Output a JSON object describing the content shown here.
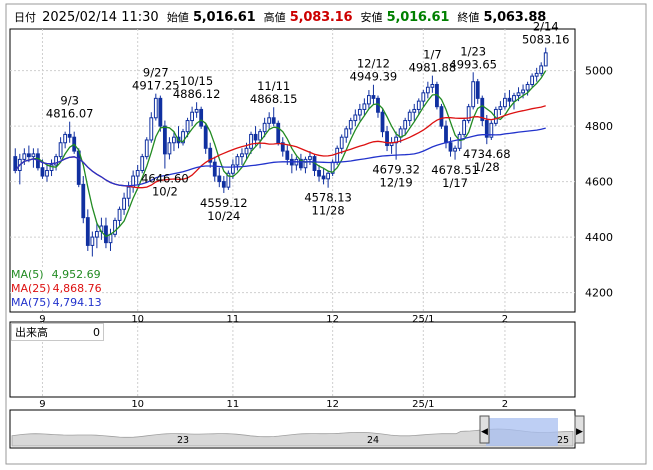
{
  "header": {
    "date_label": "日付",
    "datetime": "2025/02/14 11:30",
    "open_label": "始値",
    "open": "5,016.61",
    "high_label": "高値",
    "high": "5,083.16",
    "low_label": "安値",
    "low": "5,016.61",
    "close_label": "終値",
    "close": "5,063.88"
  },
  "legend": {
    "ma5_label": "MA(5)",
    "ma5": "4,952.69",
    "ma5_color": "#228b22",
    "ma25_label": "MA(25)",
    "ma25": "4,868.76",
    "ma25_color": "#dd1111",
    "ma75_label": "MA(75)",
    "ma75": "4,794.13",
    "ma75_color": "#2233cc"
  },
  "volume": {
    "label": "出来高",
    "value": "0"
  },
  "colors": {
    "up": "#1030a0",
    "down": "#1030a0",
    "high_text": "#cc0000",
    "low_text": "#008000"
  },
  "chart_data": {
    "type": "candlestick",
    "y_axis": {
      "ticks": [
        4200,
        4400,
        4600,
        4800,
        5000
      ],
      "range": [
        4130,
        5150
      ],
      "side": "right"
    },
    "x_axis": {
      "month_labels": [
        "9",
        "10",
        "11",
        "12",
        "25/1",
        "2"
      ]
    },
    "mini_axis_labels": [
      "23",
      "24",
      "25"
    ],
    "grid": true,
    "annotations": [
      {
        "text": "9/3",
        "price": 4816.07,
        "kind": "high",
        "date_index": 12
      },
      {
        "text": "4816.07",
        "price": 4816.07,
        "kind": "high-value",
        "date_index": 12
      },
      {
        "text": "9/27",
        "price": 4917.25,
        "kind": "high",
        "date_index": 31
      },
      {
        "text": "4917.25",
        "price": 4917.25,
        "kind": "high-value",
        "date_index": 31
      },
      {
        "text": "10/15",
        "price": 4886.12,
        "kind": "high",
        "date_index": 40
      },
      {
        "text": "4886.12",
        "price": 4886.12,
        "kind": "high-value",
        "date_index": 40
      },
      {
        "text": "4646.60",
        "price": 4646.6,
        "kind": "low-value",
        "date_index": 33
      },
      {
        "text": "10/2",
        "price": 4646.6,
        "kind": "low",
        "date_index": 33
      },
      {
        "text": "4559.12",
        "price": 4559.12,
        "kind": "low-value",
        "date_index": 46
      },
      {
        "text": "10/24",
        "price": 4559.12,
        "kind": "low",
        "date_index": 46
      },
      {
        "text": "11/11",
        "price": 4868.15,
        "kind": "high",
        "date_index": 57
      },
      {
        "text": "4868.15",
        "price": 4868.15,
        "kind": "high-value",
        "date_index": 57
      },
      {
        "text": "4578.13",
        "price": 4578.13,
        "kind": "low-value",
        "date_index": 69
      },
      {
        "text": "11/28",
        "price": 4578.13,
        "kind": "low",
        "date_index": 69
      },
      {
        "text": "12/12",
        "price": 4949.39,
        "kind": "high",
        "date_index": 79
      },
      {
        "text": "4949.39",
        "price": 4949.39,
        "kind": "high-value",
        "date_index": 79
      },
      {
        "text": "4679.32",
        "price": 4679.32,
        "kind": "low-value",
        "date_index": 84
      },
      {
        "text": "12/19",
        "price": 4679.32,
        "kind": "low",
        "date_index": 84
      },
      {
        "text": "1/7",
        "price": 4981.88,
        "kind": "high",
        "date_index": 92
      },
      {
        "text": "4981.88",
        "price": 4981.88,
        "kind": "high-value",
        "date_index": 92
      },
      {
        "text": "4678.51",
        "price": 4678.51,
        "kind": "low-value",
        "date_index": 97
      },
      {
        "text": "1/17",
        "price": 4678.51,
        "kind": "low",
        "date_index": 97
      },
      {
        "text": "1/23",
        "price": 4993.65,
        "kind": "high",
        "date_index": 101
      },
      {
        "text": "4993.65",
        "price": 4993.65,
        "kind": "high-value",
        "date_index": 101
      },
      {
        "text": "4734.68",
        "price": 4734.68,
        "kind": "low-value",
        "date_index": 104
      },
      {
        "text": "1/28",
        "price": 4734.68,
        "kind": "low",
        "date_index": 104
      },
      {
        "text": "2/14",
        "price": 5083.16,
        "kind": "high",
        "date_index": 117
      },
      {
        "text": "5083.16",
        "price": 5083.16,
        "kind": "high-value",
        "date_index": 117
      }
    ],
    "candles": [
      [
        4690,
        4720,
        4630,
        4640
      ],
      [
        4640,
        4700,
        4590,
        4680
      ],
      [
        4680,
        4720,
        4660,
        4700
      ],
      [
        4700,
        4730,
        4670,
        4690
      ],
      [
        4690,
        4720,
        4650,
        4700
      ],
      [
        4700,
        4720,
        4640,
        4650
      ],
      [
        4650,
        4680,
        4610,
        4620
      ],
      [
        4620,
        4660,
        4600,
        4640
      ],
      [
        4640,
        4680,
        4620,
        4660
      ],
      [
        4660,
        4700,
        4640,
        4690
      ],
      [
        4690,
        4760,
        4680,
        4740
      ],
      [
        4740,
        4780,
        4720,
        4770
      ],
      [
        4770,
        4816,
        4740,
        4760
      ],
      [
        4760,
        4780,
        4700,
        4710
      ],
      [
        4710,
        4720,
        4580,
        4590
      ],
      [
        4590,
        4620,
        4450,
        4470
      ],
      [
        4470,
        4500,
        4350,
        4370
      ],
      [
        4370,
        4420,
        4330,
        4400
      ],
      [
        4400,
        4450,
        4360,
        4420
      ],
      [
        4420,
        4470,
        4390,
        4440
      ],
      [
        4440,
        4470,
        4360,
        4380
      ],
      [
        4380,
        4430,
        4350,
        4410
      ],
      [
        4410,
        4470,
        4400,
        4460
      ],
      [
        4460,
        4510,
        4440,
        4500
      ],
      [
        4500,
        4560,
        4480,
        4540
      ],
      [
        4540,
        4600,
        4510,
        4580
      ],
      [
        4580,
        4640,
        4560,
        4620
      ],
      [
        4620,
        4660,
        4590,
        4640
      ],
      [
        4640,
        4700,
        4630,
        4690
      ],
      [
        4690,
        4760,
        4680,
        4750
      ],
      [
        4750,
        4850,
        4740,
        4830
      ],
      [
        4830,
        4917,
        4820,
        4900
      ],
      [
        4900,
        4910,
        4780,
        4800
      ],
      [
        4800,
        4820,
        4647,
        4700
      ],
      [
        4700,
        4760,
        4680,
        4740
      ],
      [
        4740,
        4780,
        4710,
        4760
      ],
      [
        4760,
        4800,
        4720,
        4740
      ],
      [
        4740,
        4790,
        4730,
        4780
      ],
      [
        4780,
        4830,
        4760,
        4820
      ],
      [
        4820,
        4870,
        4800,
        4850
      ],
      [
        4850,
        4886,
        4830,
        4860
      ],
      [
        4860,
        4870,
        4790,
        4800
      ],
      [
        4800,
        4810,
        4700,
        4720
      ],
      [
        4720,
        4740,
        4650,
        4670
      ],
      [
        4670,
        4690,
        4600,
        4620
      ],
      [
        4620,
        4650,
        4580,
        4600
      ],
      [
        4600,
        4620,
        4559,
        4580
      ],
      [
        4580,
        4640,
        4570,
        4630
      ],
      [
        4630,
        4680,
        4610,
        4660
      ],
      [
        4660,
        4700,
        4640,
        4690
      ],
      [
        4690,
        4720,
        4660,
        4700
      ],
      [
        4700,
        4740,
        4680,
        4720
      ],
      [
        4720,
        4780,
        4700,
        4770
      ],
      [
        4770,
        4800,
        4730,
        4750
      ],
      [
        4750,
        4790,
        4720,
        4780
      ],
      [
        4780,
        4830,
        4760,
        4810
      ],
      [
        4810,
        4850,
        4790,
        4830
      ],
      [
        4830,
        4868,
        4800,
        4810
      ],
      [
        4810,
        4820,
        4730,
        4740
      ],
      [
        4740,
        4760,
        4690,
        4710
      ],
      [
        4710,
        4730,
        4660,
        4680
      ],
      [
        4680,
        4700,
        4630,
        4660
      ],
      [
        4660,
        4690,
        4640,
        4680
      ],
      [
        4680,
        4700,
        4640,
        4650
      ],
      [
        4650,
        4690,
        4630,
        4680
      ],
      [
        4680,
        4710,
        4660,
        4690
      ],
      [
        4690,
        4700,
        4620,
        4640
      ],
      [
        4640,
        4660,
        4600,
        4620
      ],
      [
        4620,
        4650,
        4590,
        4610
      ],
      [
        4610,
        4640,
        4578,
        4630
      ],
      [
        4630,
        4680,
        4620,
        4670
      ],
      [
        4670,
        4730,
        4660,
        4720
      ],
      [
        4720,
        4770,
        4700,
        4760
      ],
      [
        4760,
        4800,
        4740,
        4790
      ],
      [
        4790,
        4830,
        4770,
        4820
      ],
      [
        4820,
        4860,
        4800,
        4840
      ],
      [
        4840,
        4880,
        4820,
        4860
      ],
      [
        4860,
        4900,
        4840,
        4880
      ],
      [
        4880,
        4930,
        4860,
        4910
      ],
      [
        4910,
        4949,
        4880,
        4900
      ],
      [
        4900,
        4910,
        4830,
        4850
      ],
      [
        4850,
        4860,
        4760,
        4780
      ],
      [
        4780,
        4800,
        4710,
        4730
      ],
      [
        4730,
        4760,
        4700,
        4740
      ],
      [
        4740,
        4780,
        4679,
        4760
      ],
      [
        4760,
        4800,
        4740,
        4790
      ],
      [
        4790,
        4830,
        4770,
        4820
      ],
      [
        4820,
        4860,
        4800,
        4850
      ],
      [
        4850,
        4880,
        4820,
        4860
      ],
      [
        4860,
        4900,
        4840,
        4890
      ],
      [
        4890,
        4930,
        4870,
        4920
      ],
      [
        4920,
        4960,
        4900,
        4940
      ],
      [
        4940,
        4982,
        4920,
        4950
      ],
      [
        4950,
        4960,
        4860,
        4870
      ],
      [
        4870,
        4880,
        4790,
        4800
      ],
      [
        4800,
        4820,
        4720,
        4740
      ],
      [
        4740,
        4760,
        4690,
        4710
      ],
      [
        4710,
        4730,
        4679,
        4720
      ],
      [
        4720,
        4780,
        4710,
        4770
      ],
      [
        4770,
        4830,
        4760,
        4820
      ],
      [
        4820,
        4880,
        4810,
        4870
      ],
      [
        4870,
        4994,
        4860,
        4960
      ],
      [
        4960,
        4970,
        4880,
        4900
      ],
      [
        4900,
        4910,
        4800,
        4820
      ],
      [
        4820,
        4840,
        4735,
        4760
      ],
      [
        4760,
        4820,
        4750,
        4810
      ],
      [
        4810,
        4870,
        4800,
        4860
      ],
      [
        4860,
        4890,
        4840,
        4870
      ],
      [
        4870,
        4920,
        4860,
        4900
      ],
      [
        4900,
        4930,
        4870,
        4890
      ],
      [
        4890,
        4920,
        4860,
        4910
      ],
      [
        4910,
        4940,
        4890,
        4920
      ],
      [
        4920,
        4950,
        4900,
        4930
      ],
      [
        4930,
        4960,
        4910,
        4950
      ],
      [
        4950,
        4990,
        4940,
        4980
      ],
      [
        4980,
        5010,
        4960,
        4990
      ],
      [
        4990,
        5030,
        4980,
        5017
      ],
      [
        5017,
        5083,
        5017,
        5064
      ]
    ],
    "ma_series_labels": [
      "MA(5)",
      "MA(25)",
      "MA(75)"
    ]
  }
}
